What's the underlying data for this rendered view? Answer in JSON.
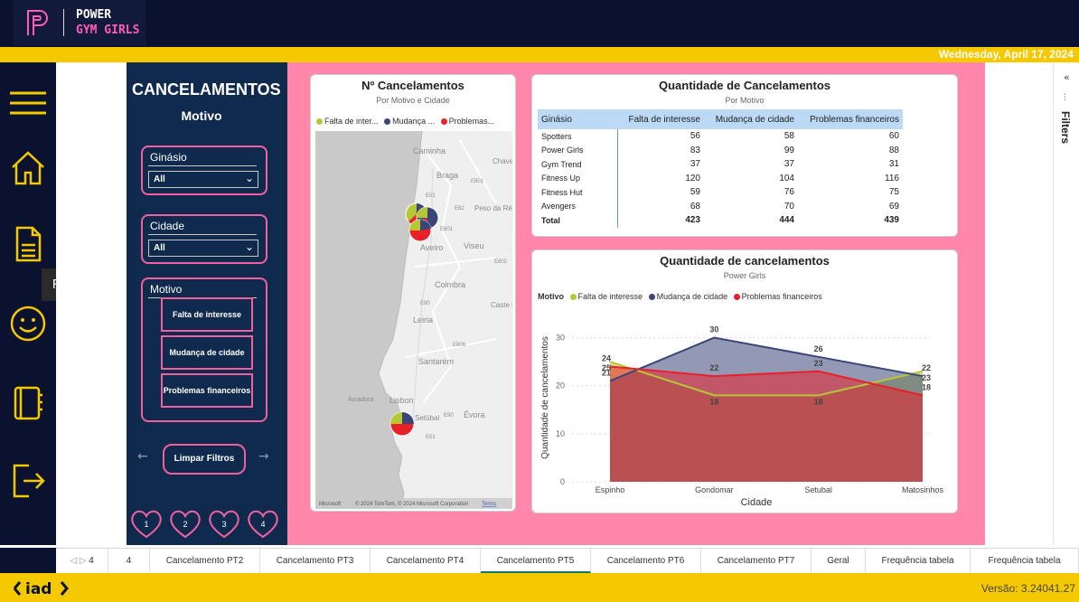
{
  "brand": {
    "line1": "POWER",
    "line2": "GYM GIRLS"
  },
  "date": "Wednesday, April 17, 2024",
  "nav": {
    "icons": [
      "menu-icon",
      "home-icon",
      "report-icon",
      "smiley-icon",
      "notebook-icon",
      "logout-icon"
    ],
    "tooltip": "REPORT"
  },
  "filters_label": "Filters",
  "side": {
    "title": "CANCELAMENTOS",
    "subtitle": "Motivo",
    "gym_label": "Ginásio",
    "gym_value": "All",
    "city_label": "Cidade",
    "city_value": "All",
    "motivo_label": "Motivo",
    "motivo_buttons": [
      "Falta de interesse",
      "Mudança de cidade",
      "Problemas financeiros"
    ],
    "clear_label": "Limpar Filtros",
    "pages": [
      "1",
      "2",
      "3",
      "4"
    ]
  },
  "map_card": {
    "title": "Nº Cancelamentos",
    "subtitle": "Por Motivo e Cidade",
    "legend": [
      "Falta de inter...",
      "Mudança ...",
      "Problemas..."
    ],
    "places": [
      "Caminha",
      "Chave",
      "Braga",
      "E801",
      "E01",
      "E82",
      "Peso da Ré",
      "E801",
      "Aveiro",
      "Viseu",
      "E802",
      "Coimbra",
      "E80",
      "Caste Branc",
      "Leiria",
      "E806",
      "Santarém",
      "Amadora",
      "Lisbon",
      "E90",
      "Évora",
      "Setúbal",
      "E01"
    ],
    "attribution": "© 2024 TomTom, © 2024 Microsoft Corporation",
    "terms": "Terms",
    "ms": "Microsoft"
  },
  "table_card": {
    "title": "Quantidade de Cancelamentos",
    "subtitle": "Por Motivo",
    "columns": [
      "Ginásio",
      "Falta de interesse",
      "Mudança de cidade",
      "Problemas financeiros"
    ],
    "rows": [
      [
        "Spotters",
        "56",
        "58",
        "60"
      ],
      [
        "Power Girls",
        "83",
        "99",
        "88"
      ],
      [
        "Gym Trend",
        "37",
        "37",
        "31"
      ],
      [
        "Fitness Up",
        "120",
        "104",
        "116"
      ],
      [
        "Fitness Hut",
        "59",
        "76",
        "75"
      ],
      [
        "Avengers",
        "68",
        "70",
        "69"
      ],
      [
        "Total",
        "423",
        "444",
        "439"
      ]
    ]
  },
  "chart_card": {
    "title": "Quantidade de cancelamentos",
    "subtitle": "Power Girls",
    "legend_title": "Motivo"
  },
  "chart_data": {
    "type": "area",
    "categories": [
      "Espinho",
      "Gondomar",
      "Setubal",
      "Matosinhos"
    ],
    "series": [
      {
        "name": "Falta de interesse",
        "values": [
          25,
          18,
          18,
          23
        ],
        "color": "#b5c834"
      },
      {
        "name": "Mudança de cidade",
        "values": [
          21,
          30,
          26,
          22
        ],
        "color": "#3b4678"
      },
      {
        "name": "Problemas financeiros",
        "values": [
          24,
          22,
          23,
          18
        ],
        "color": "#e8202a"
      }
    ],
    "xlabel": "Cidade",
    "ylabel": "Quantidade de cancelamentos",
    "ylim": [
      0,
      35
    ],
    "yticks": [
      0,
      10,
      20,
      30
    ],
    "grid": true,
    "legend": "top-left"
  },
  "tabs": [
    "4",
    "Cancelamento PT2",
    "Cancelamento PT3",
    "Cancelamento PT4",
    "Cancelamento PT5",
    "Cancelamento PT6",
    "Cancelamento PT7",
    "Geral",
    "Frequência tabela",
    "Frequência tabela"
  ],
  "active_tab": 4,
  "tab_nav": {
    "prev": "◁",
    "next": "▷",
    "page": "4"
  },
  "version": "Versão: 3.24041.27",
  "footer_logo": "iad"
}
